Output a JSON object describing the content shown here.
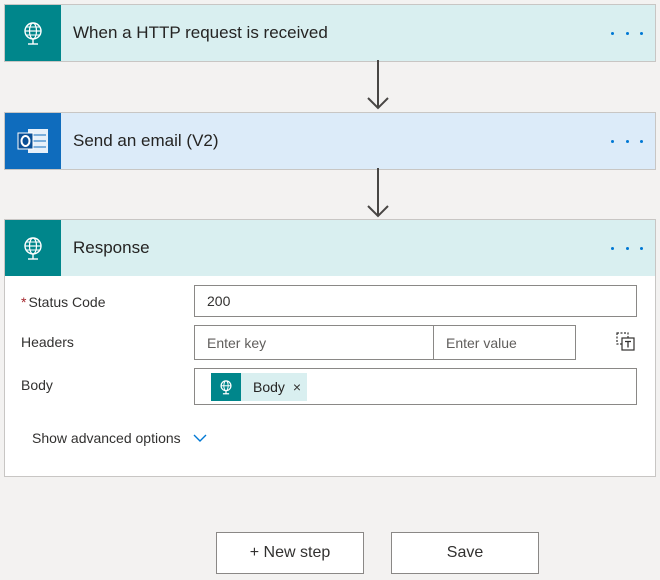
{
  "steps": [
    {
      "title": "When a HTTP request is received",
      "icon": "http-globe-icon",
      "color": "#00868b"
    },
    {
      "title": "Send an email (V2)",
      "icon": "outlook-icon",
      "color": "#0f6cbd"
    },
    {
      "title": "Response",
      "icon": "http-globe-icon",
      "color": "#00868b"
    }
  ],
  "response": {
    "status_code_label": "Status Code",
    "status_code_value": "200",
    "headers_label": "Headers",
    "header_key_placeholder": "Enter key",
    "header_value_placeholder": "Enter value",
    "body_label": "Body",
    "body_token": "Body",
    "token_remove": "×",
    "required_marker": "*",
    "advanced": "Show advanced options"
  },
  "footer": {
    "new_step": "+ New step",
    "save": "Save"
  }
}
